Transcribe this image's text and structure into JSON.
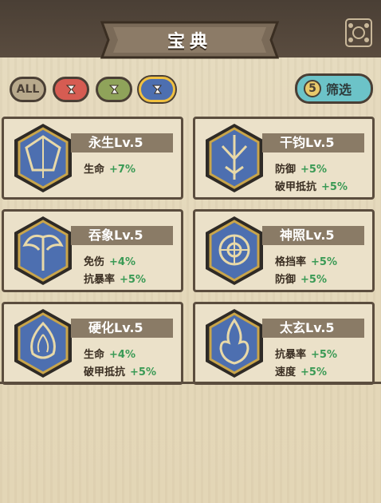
{
  "header": {
    "title": "宝典"
  },
  "filters": [
    {
      "label": "ALL",
      "color": "#b8a98c"
    },
    {
      "label": "",
      "color": "#d65c52"
    },
    {
      "label": "",
      "color": "#8fa35a"
    },
    {
      "label": "",
      "color": "#4d6fb0",
      "selected": true
    }
  ],
  "screen": {
    "count": "5",
    "label": "筛选"
  },
  "cards": [
    {
      "name": "永生Lv.5",
      "stats": [
        {
          "label": "生命",
          "value": "+7%"
        }
      ]
    },
    {
      "name": "干钧Lv.5",
      "stats": [
        {
          "label": "防御",
          "value": "+5%"
        },
        {
          "label": "破甲抵抗",
          "value": "+5%"
        }
      ]
    },
    {
      "name": "吞象Lv.5",
      "stats": [
        {
          "label": "免伤",
          "value": "+4%"
        },
        {
          "label": "抗暴率",
          "value": "+5%"
        }
      ]
    },
    {
      "name": "神照Lv.5",
      "stats": [
        {
          "label": "格挡率",
          "value": "+5%"
        },
        {
          "label": "防御",
          "value": "+5%"
        }
      ]
    },
    {
      "name": "硬化Lv.5",
      "stats": [
        {
          "label": "生命",
          "value": "+4%"
        },
        {
          "label": "破甲抵抗",
          "value": "+5%"
        }
      ]
    },
    {
      "name": "太玄Lv.5",
      "stats": [
        {
          "label": "抗暴率",
          "value": "+5%"
        },
        {
          "label": "速度",
          "value": "+5%"
        }
      ]
    }
  ],
  "colors": {
    "positive": "#3a9a55",
    "gem_blue": "#4d6fb0",
    "gem_gold": "#c9a54a"
  }
}
